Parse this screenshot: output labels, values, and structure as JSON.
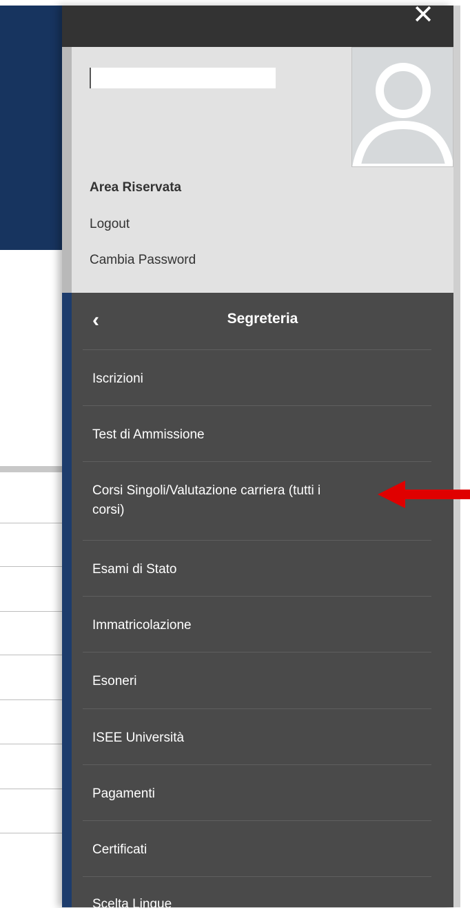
{
  "user": {
    "area_title": "Area Riservata",
    "logout_label": "Logout",
    "change_password_label": "Cambia Password"
  },
  "menu": {
    "title": "Segreteria",
    "items": [
      {
        "label": "Iscrizioni"
      },
      {
        "label": "Test di Ammissione"
      },
      {
        "label": "Corsi Singoli/Valutazione carriera (tutti i",
        "label2": "corsi)"
      },
      {
        "label": "Esami di Stato"
      },
      {
        "label": "Immatricolazione"
      },
      {
        "label": "Esoneri"
      },
      {
        "label": "ISEE Università"
      },
      {
        "label": "Pagamenti"
      },
      {
        "label": "Certificati"
      },
      {
        "label": "Scelta Lingue"
      }
    ]
  },
  "colors": {
    "menu_bg": "#4a4a4a",
    "user_bg": "#e2e2e2",
    "accent_blue": "#1d3c6c",
    "annotation_red": "#e00000"
  },
  "icons": {
    "close": "close-icon",
    "back": "chevron-left-icon",
    "avatar": "user-avatar-icon",
    "annotation": "red-arrow-icon"
  }
}
